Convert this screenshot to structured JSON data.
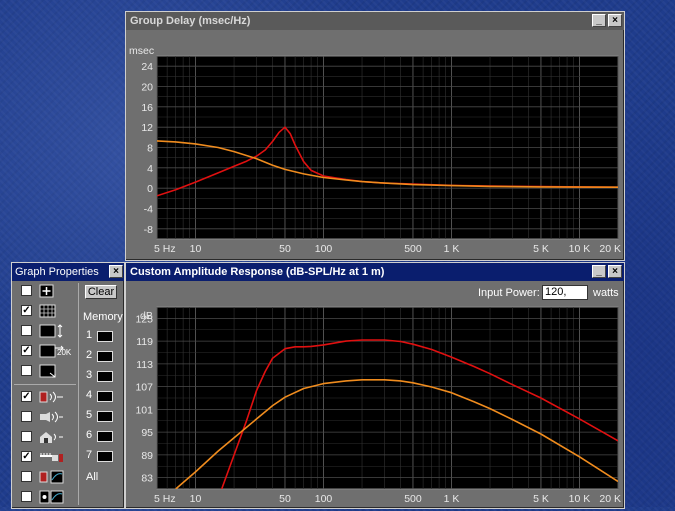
{
  "group_delay_window": {
    "title": "Group Delay (msec/Hz)",
    "minimize_label": "_",
    "close_label": "×"
  },
  "amplitude_window": {
    "title": "Custom Amplitude Response (dB-SPL/Hz at 1 m)",
    "minimize_label": "_",
    "close_label": "×",
    "input_power_label": "Input Power:",
    "input_power_value": "120,",
    "input_power_unit": "watts"
  },
  "graph_properties": {
    "title": "Graph Properties",
    "close_label": "×",
    "clear_label": "Clear",
    "memory_label": "Memory",
    "memory_slots": [
      "1",
      "2",
      "3",
      "4",
      "5",
      "6",
      "7"
    ],
    "all_label": "All",
    "zoom_label": "20K",
    "rows": [
      {
        "checked": false,
        "icon": "plus-icon"
      },
      {
        "checked": true,
        "icon": "grid-icon"
      },
      {
        "checked": false,
        "icon": "vertical-scale-icon"
      },
      {
        "checked": true,
        "icon": "horizontal-scale-icon"
      },
      {
        "checked": false,
        "icon": "export-icon"
      },
      {
        "checked": true,
        "icon": "speaker-icon"
      },
      {
        "checked": false,
        "icon": "horn-icon"
      },
      {
        "checked": false,
        "icon": "room-icon"
      },
      {
        "checked": true,
        "icon": "amplifier-icon"
      },
      {
        "checked": false,
        "icon": "speaker-meter-icon"
      },
      {
        "checked": false,
        "icon": "phase-icon"
      }
    ]
  },
  "chart_data": [
    {
      "type": "line",
      "title": "Group Delay (msec/Hz)",
      "ylabel": "msec",
      "xscale": "log",
      "xlim": [
        5,
        20000
      ],
      "ylim": [
        -10,
        26
      ],
      "y_ticks": [
        "24",
        "20",
        "16",
        "12",
        "8",
        "4",
        "0",
        "-4",
        "-8"
      ],
      "x_ticks": [
        "5 Hz",
        "10",
        "50",
        "100",
        "500",
        "1 K",
        "5 K",
        "10 K",
        "20 K"
      ],
      "grid": true,
      "series": [
        {
          "color": "#e01010",
          "x": [
            5,
            7,
            10,
            15,
            20,
            25,
            30,
            35,
            40,
            45,
            50,
            55,
            60,
            70,
            80,
            100,
            150,
            200,
            300,
            500,
            1000,
            2000,
            5000,
            10000,
            20000
          ],
          "values": [
            -1.5,
            -0.3,
            1.2,
            3,
            4.3,
            5.3,
            6.3,
            7.5,
            9.2,
            11,
            12,
            10.7,
            8.5,
            5.2,
            3.5,
            2.4,
            1.7,
            1.3,
            1.0,
            0.8,
            0.55,
            0.4,
            0.3,
            0.25,
            0.2
          ]
        },
        {
          "color": "#f08c1e",
          "x": [
            5,
            7,
            10,
            15,
            20,
            30,
            40,
            50,
            70,
            100,
            150,
            200,
            300,
            500,
            1000,
            2000,
            5000,
            20000
          ],
          "values": [
            9.3,
            9.1,
            8.7,
            8,
            7.2,
            5.8,
            4.5,
            3.7,
            2.8,
            2.1,
            1.6,
            1.3,
            1.0,
            0.7,
            0.5,
            0.35,
            0.25,
            0.2
          ]
        }
      ]
    },
    {
      "type": "line",
      "title": "Custom Amplitude Response (dB-SPL/Hz at 1 m)",
      "ylabel": "dB",
      "xscale": "log",
      "xlim": [
        5,
        20000
      ],
      "ylim": [
        80,
        128
      ],
      "y_ticks": [
        "125",
        "119",
        "113",
        "107",
        "101",
        "95",
        "89",
        "83"
      ],
      "x_ticks": [
        "5 Hz",
        "10",
        "50",
        "100",
        "500",
        "1 K",
        "5 K",
        "10 K",
        "20 K"
      ],
      "grid": true,
      "series": [
        {
          "color": "#e01010",
          "x": [
            16,
            20,
            25,
            30,
            35,
            40,
            50,
            60,
            70,
            80,
            100,
            150,
            200,
            300,
            400,
            500,
            700,
            1000,
            1500,
            2000,
            3000,
            5000,
            10000,
            20000
          ],
          "values": [
            80,
            89,
            98,
            106,
            111,
            114.5,
            117,
            117.5,
            117.5,
            117.6,
            118,
            119,
            119.3,
            119.3,
            118.9,
            118.2,
            116.8,
            114.8,
            112.3,
            110.4,
            107.5,
            104,
            98.5,
            92.7
          ]
        },
        {
          "color": "#f08c1e",
          "x": [
            7,
            10,
            15,
            20,
            30,
            40,
            50,
            70,
            100,
            150,
            200,
            300,
            400,
            500,
            700,
            1000,
            1500,
            2000,
            3000,
            5000,
            10000,
            20000
          ],
          "values": [
            80,
            84.5,
            90,
            93.5,
            98.5,
            102,
            104.2,
            106.5,
            107.8,
            108.5,
            108.8,
            108.8,
            108.5,
            108,
            106.9,
            105.4,
            103,
            101.2,
            98.3,
            94.5,
            88.5,
            82
          ]
        }
      ]
    }
  ]
}
